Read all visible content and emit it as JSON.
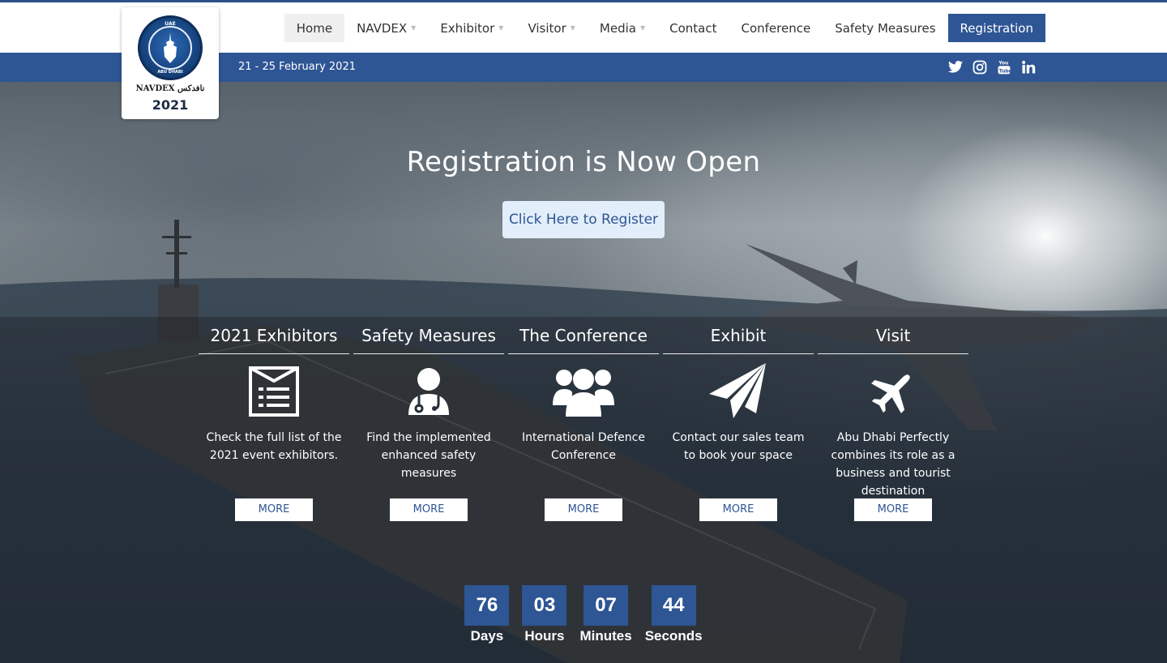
{
  "nav": {
    "items": [
      {
        "label": "Home",
        "dropdown": false,
        "active": true
      },
      {
        "label": "NAVDEX",
        "dropdown": true
      },
      {
        "label": "Exhibitor",
        "dropdown": true
      },
      {
        "label": "Visitor",
        "dropdown": true
      },
      {
        "label": "Media",
        "dropdown": true
      },
      {
        "label": "Contact",
        "dropdown": false
      },
      {
        "label": "Conference",
        "dropdown": false
      },
      {
        "label": "Safety Measures",
        "dropdown": false
      }
    ],
    "registration": "Registration"
  },
  "logo": {
    "ring_top": "UAE",
    "ring_bottom": "ABU DHABI",
    "wordmark": "NAVDEX نافدكس",
    "year": "2021"
  },
  "topbar": {
    "dates": "21 - 25 February 2021",
    "socials": [
      "twitter-icon",
      "instagram-icon",
      "youtube-icon",
      "linkedin-icon"
    ]
  },
  "hero": {
    "title": "Registration is Now Open",
    "button": "Click Here to Register"
  },
  "cards": [
    {
      "title": "2021 Exhibitors",
      "icon": "list-icon",
      "desc": "Check the full list of the 2021 event exhibitors.",
      "more": "MORE"
    },
    {
      "title": "Safety Measures",
      "icon": "doctor-icon",
      "desc": "Find the implemented enhanced safety measures",
      "more": "MORE"
    },
    {
      "title": "The Conference",
      "icon": "group-icon",
      "desc": "International Defence Conference",
      "more": "MORE"
    },
    {
      "title": "Exhibit",
      "icon": "paper-plane-icon",
      "desc": "Contact our sales team to book your space",
      "more": "MORE"
    },
    {
      "title": "Visit",
      "icon": "airplane-icon",
      "desc": "Abu Dhabi Perfectly combines its role as a business and tourist destination",
      "more": "MORE"
    }
  ],
  "countdown": [
    {
      "value": "76",
      "label": "Days"
    },
    {
      "value": "03",
      "label": "Hours"
    },
    {
      "value": "07",
      "label": "Minutes"
    },
    {
      "value": "44",
      "label": "Seconds"
    }
  ],
  "colors": {
    "brand_blue": "#2e5594",
    "button_light": "#e2eefa"
  }
}
